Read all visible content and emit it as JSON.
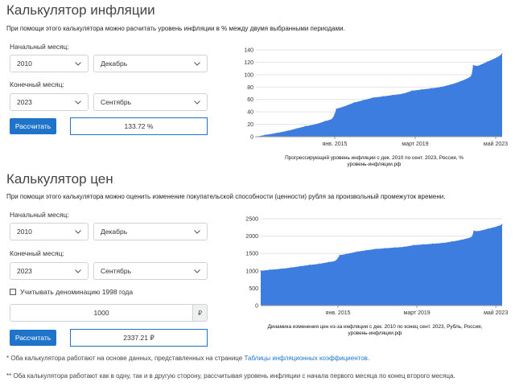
{
  "inflation": {
    "title": "Калькулятор инфляции",
    "description": "При помощи этого калькулятора можно расчитать уровень инфляции в % между двумя выбранными периодами.",
    "start_label": "Начальный месяц:",
    "start_year": "2010",
    "start_month": "Декабрь",
    "end_label": "Конечный месяц:",
    "end_year": "2023",
    "end_month": "Сентябрь",
    "button": "Рассчитать",
    "result": "133.72 %",
    "chart_caption_1": "Прогрессирующий уровень инфляции с дек. 2010 по сент. 2023, Россия, %",
    "chart_caption_2": "уровень-инфляции.рф"
  },
  "prices": {
    "title": "Калькулятор цен",
    "description": "При помощи этого калькулятора можно оценить изменение покупательской способности (ценности) рубля за произвольный промежуток времени.",
    "start_label": "Начальный месяц:",
    "start_year": "2010",
    "start_month": "Декабрь",
    "end_label": "Конечный месяц:",
    "end_year": "2023",
    "end_month": "Сентябрь",
    "denomination_label": "Учитывать деноминацию 1998 года",
    "amount": "1000",
    "currency": "₽",
    "button": "Рассчитать",
    "result": "2337.21 ₽",
    "chart_caption_1": "Динамика изменения цен из-за инфляции с дек. 2010 по конец сент. 2023, Рубль, Россия,",
    "chart_caption_2": "уровень-инфляции.рф"
  },
  "footnotes": {
    "note1_prefix": "* Оба калькулятора работают на основе данных, представленных на странице ",
    "note1_link": "Таблицы инфляционных коэффициентов",
    "note1_suffix": ".",
    "note2": "** Оба калькулятора работают как в одну, так и в другую сторону, рассчитывая уровень инфляции с начала первого месяца по конец второго месяца."
  },
  "colors": {
    "accent": "#1f74c9",
    "area": "#3d7de0"
  },
  "icons": {
    "select_arrow": "chevron-down-icon"
  },
  "chart_data": [
    {
      "type": "area",
      "x_ticks": [
        "янв. 2015",
        "март 2019",
        "май 2023"
      ],
      "y_ticks": [
        0,
        20,
        40,
        60,
        80,
        100,
        120,
        140
      ],
      "ylim": [
        0,
        140
      ],
      "x": [
        "2010-12",
        "2011-06",
        "2012-01",
        "2012-07",
        "2013-01",
        "2013-07",
        "2014-01",
        "2014-07",
        "2014-11",
        "2014-12",
        "2015-01",
        "2015-02",
        "2015-06",
        "2016-01",
        "2016-07",
        "2017-01",
        "2017-07",
        "2018-01",
        "2018-07",
        "2019-01",
        "2019-07",
        "2020-01",
        "2020-07",
        "2021-01",
        "2021-07",
        "2022-01",
        "2022-02",
        "2022-03",
        "2022-06",
        "2022-12",
        "2023-06",
        "2023-09"
      ],
      "values": [
        0,
        3,
        6,
        9,
        13,
        17,
        20,
        25,
        28,
        31,
        37,
        45,
        48,
        55,
        59,
        63,
        65,
        67,
        69,
        74,
        76,
        78,
        80,
        84,
        89,
        96,
        99,
        115,
        114,
        121,
        128,
        133.72
      ],
      "title": "Прогрессирующий уровень инфляции с дек. 2010 по сент. 2023, Россия, %",
      "grid": true
    },
    {
      "type": "area",
      "x_ticks": [
        "янв. 2015",
        "март 2019",
        "май 2023"
      ],
      "y_ticks": [
        0,
        500,
        1000,
        1500,
        2000,
        2500
      ],
      "ylim": [
        0,
        2500
      ],
      "x": [
        "2010-12",
        "2011-06",
        "2012-01",
        "2012-07",
        "2013-01",
        "2013-07",
        "2014-01",
        "2014-07",
        "2014-11",
        "2014-12",
        "2015-01",
        "2015-02",
        "2015-06",
        "2016-01",
        "2016-07",
        "2017-01",
        "2017-07",
        "2018-01",
        "2018-07",
        "2019-01",
        "2019-07",
        "2020-01",
        "2020-07",
        "2021-01",
        "2021-07",
        "2022-01",
        "2022-02",
        "2022-03",
        "2022-06",
        "2022-12",
        "2023-06",
        "2023-09"
      ],
      "values": [
        1000,
        1030,
        1060,
        1090,
        1130,
        1170,
        1200,
        1250,
        1280,
        1310,
        1370,
        1450,
        1480,
        1550,
        1590,
        1630,
        1650,
        1670,
        1690,
        1740,
        1760,
        1780,
        1800,
        1840,
        1890,
        1960,
        1990,
        2150,
        2140,
        2210,
        2280,
        2337.21
      ],
      "title": "Динамика изменения цен из-за инфляции с дек. 2010 по конец сент. 2023, Рубль, Россия,",
      "grid": true
    }
  ]
}
